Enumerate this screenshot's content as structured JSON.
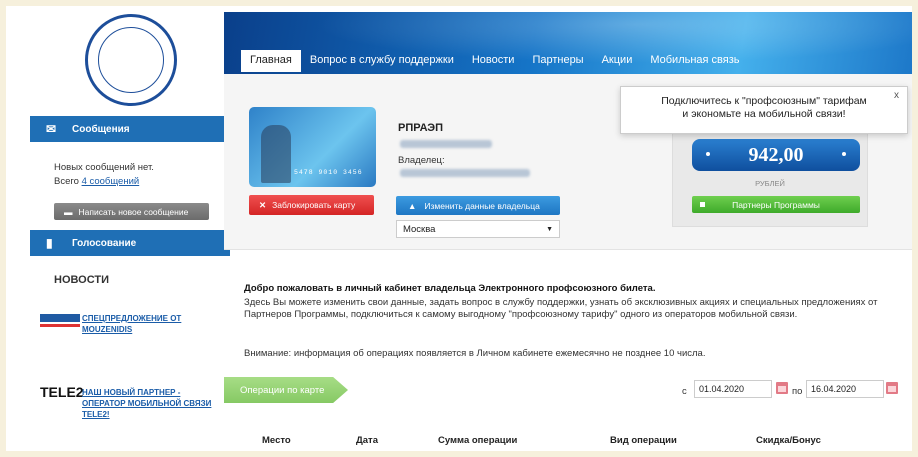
{
  "nav": {
    "tabs": [
      {
        "label": "Главная",
        "active": true
      },
      {
        "label": "Вопрос в службу поддержки"
      },
      {
        "label": "Новости"
      },
      {
        "label": "Партнеры"
      },
      {
        "label": "Акции"
      },
      {
        "label": "Мобильная связь"
      }
    ]
  },
  "sidebar": {
    "messages_header": "Сообщения",
    "no_new": "Новых сообщений нет.",
    "total_prefix": "Всего",
    "total_link": "4 сообщений",
    "write_button": "Написать новое сообщение",
    "voting_header": "Голосование",
    "news_title": "НОВОСТИ",
    "news": [
      {
        "link": "СПЕЦПРЕДЛОЖЕНИЕ ОТ MOUZENIDIS",
        "logo": "mouzenidis-logo"
      },
      {
        "link": "НАШ НОВЫЙ ПАРТНЕР - ОПЕРАТОР МОБИЛЬНОЙ СВЯЗИ TELE2!",
        "logo_text": "TELE2"
      }
    ]
  },
  "card": {
    "number": "5478 9010 3456",
    "block_button": "Заблокировать карту"
  },
  "owner": {
    "org": "РПРАЭП",
    "owner_label": "Владелец:",
    "edit_button": "Изменить данные владельца",
    "city": "Москва"
  },
  "balance": {
    "value": "942,00",
    "currency": "РУБЛЕЙ",
    "partners_button": "Партнеры Программы"
  },
  "tooltip": {
    "text_line1": "Подключитесь к \"профсоюзным\" тарифам",
    "text_line2": "и экономьте на мобильной связи!",
    "close": "x"
  },
  "welcome": {
    "title": "Добро пожаловать в личный кабинет владельца Электронного профсоюзного билета.",
    "text": "Здесь Вы можете изменить свои данные, задать вопрос в службу поддержки, узнать об эксклюзивных акциях и специальных предложениях от Партнеров Программы, подключиться к самому выгодному \"профсоюзному тарифу\" одного из операторов мобильной связи.",
    "notice": "Внимание: информация об операциях появляется в Личном кабинете ежемесячно не позднее 10 числа."
  },
  "operations": {
    "tab": "Операции по карте",
    "from_label": "с",
    "from": "01.04.2020",
    "to_label": "по",
    "to": "16.04.2020",
    "columns": [
      "Место",
      "Дата",
      "Сумма операции",
      "Вид операции",
      "Скидка/Бонус"
    ]
  },
  "colors": {
    "brand_blue": "#1f6fb5",
    "red": "#d42525",
    "green": "#3eaa2a"
  }
}
